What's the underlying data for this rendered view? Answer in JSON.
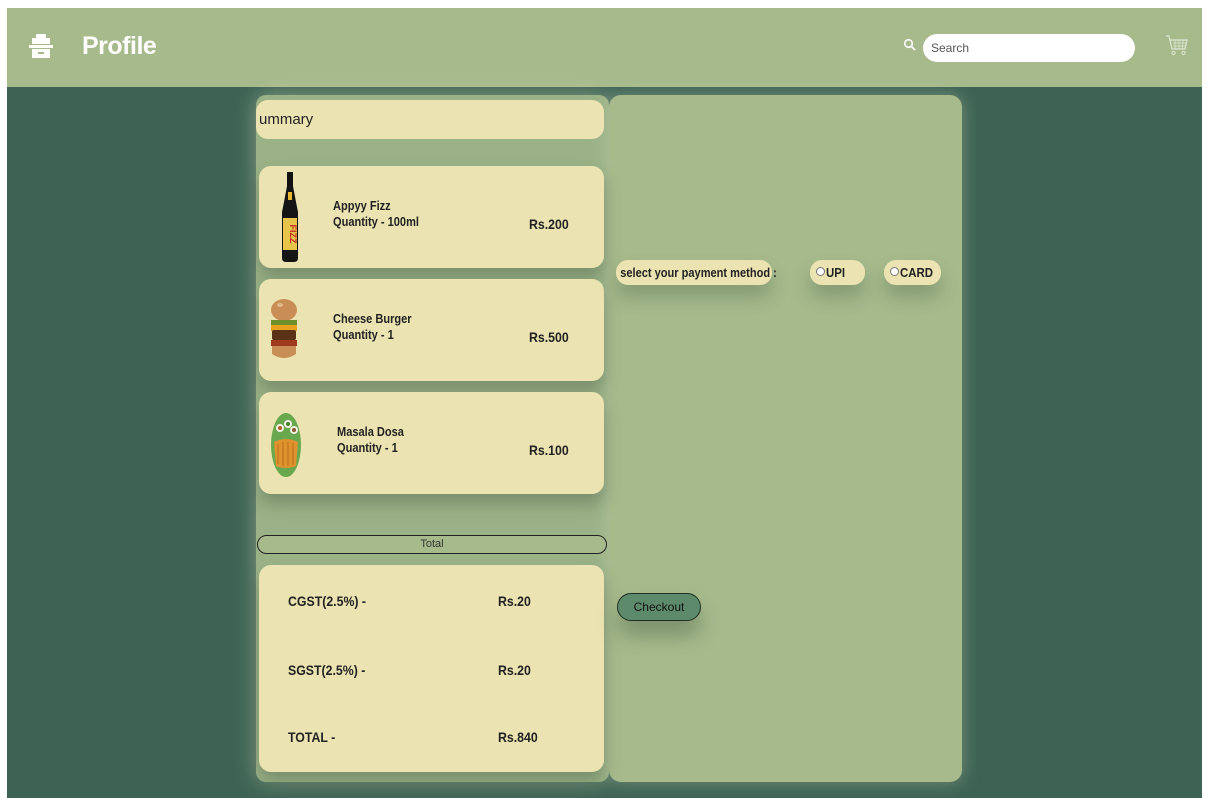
{
  "header": {
    "title": "Profile",
    "logo_icon": "briefcase-icon",
    "search": {
      "placeholder": "Search",
      "value": "",
      "icon": "search-icon"
    },
    "cart_icon": "cart-icon"
  },
  "summary": {
    "heading": "ummary",
    "items": [
      {
        "name": "Appyy Fizz",
        "quantity": "Quantity - 100ml",
        "price": "Rs.200",
        "image": "fizz-bottle-image"
      },
      {
        "name": "Cheese Burger",
        "quantity": "Quantity - 1",
        "price": "Rs.500",
        "image": "burger-image"
      },
      {
        "name": "Masala Dosa",
        "quantity": "Quantity - 1",
        "price": "Rs.100",
        "image": "dosa-image"
      }
    ],
    "total_label": "Total",
    "taxes": [
      {
        "label": "CGST(2.5%)   -",
        "value": "Rs.20"
      },
      {
        "label": "SGST(2.5%)   -",
        "value": "Rs.20"
      },
      {
        "label": "TOTAL   -",
        "value": "Rs.840"
      }
    ]
  },
  "payment": {
    "label": "select your payment method :",
    "options": [
      "UPI",
      "CARD"
    ],
    "checkout_label": "Checkout"
  },
  "colors": {
    "background": "#3d6354",
    "header": "#a6ba8c",
    "card": "#ebe4b2",
    "panel": "#a6ba8c",
    "checkout": "#5e8a6c"
  }
}
